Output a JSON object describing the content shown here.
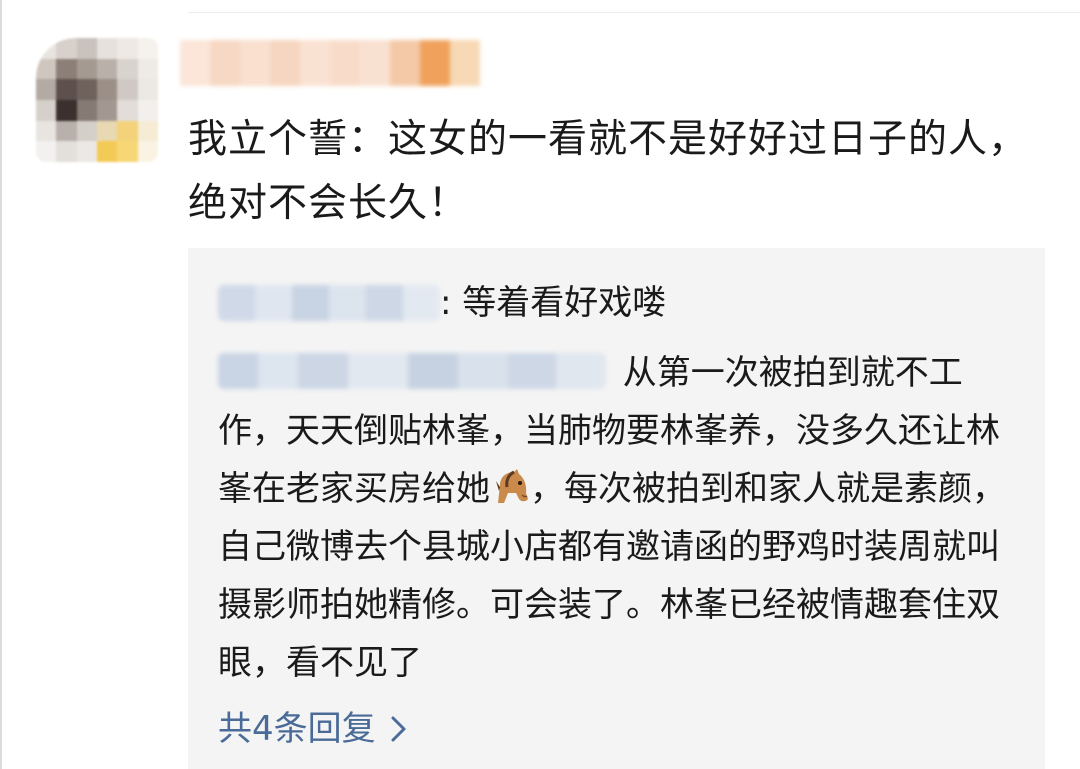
{
  "comment": {
    "text": "我立个誓：这女的一看就不是好好过日子的人，绝对不会长久！"
  },
  "replies": [
    {
      "text": ": 等着看好戏喽"
    },
    {
      "text_before_icon": " 从第一次被拍到就不工作，天天倒贴林峯，当肺物要林峯养，没多久还让林峯在老家买房给她",
      "icon": "horse-face-icon",
      "text_after_icon": "，每次被拍到和家人就是素颜，自己微博去个县城小店都有邀请函的野鸡时装周就叫摄影师拍她精修。可会装了。林峯已经被情趣套住双眼，看不见了"
    }
  ],
  "more_replies_label": "共4条回复",
  "colors": {
    "link": "#4a6b97",
    "reply_bg": "#f4f4f4",
    "text": "#1a1a1a"
  }
}
